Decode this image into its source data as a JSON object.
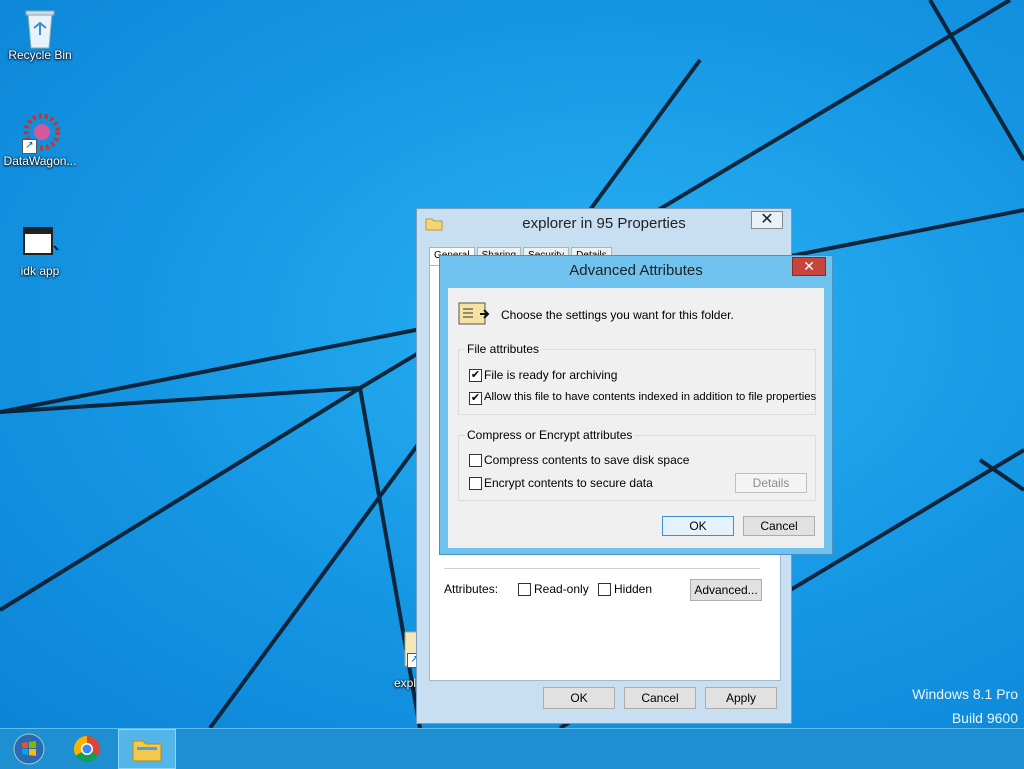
{
  "desktop": {
    "icons": [
      {
        "label": "Recycle Bin",
        "icon": "recycle-bin-icon"
      },
      {
        "label": "DataWagon...",
        "icon": "datawagon-icon"
      },
      {
        "label": "idk app",
        "icon": "app-icon"
      },
      {
        "label": "expl",
        "icon": "explorer-shortcut-icon"
      }
    ],
    "watermark": {
      "line1": "Windows 8.1 Pro",
      "line2": "Build 9600"
    }
  },
  "properties_window": {
    "title": "explorer in 95 Properties",
    "tabs": [
      "General",
      "Sharing",
      "Security",
      "Details"
    ],
    "attributes_label": "Attributes:",
    "readonly_label": "Read-only",
    "readonly_checked": false,
    "hidden_label": "Hidden",
    "hidden_checked": false,
    "advanced_button": "Advanced...",
    "ok": "OK",
    "cancel": "Cancel",
    "apply": "Apply"
  },
  "advanced_dialog": {
    "title": "Advanced Attributes",
    "close": "✕",
    "intro": "Choose the settings you want for this folder.",
    "file_attributes": {
      "title": "File attributes",
      "archive_label": "File is ready for archiving",
      "archive_checked": true,
      "index_label": "Allow this file to have contents indexed in addition to file properties",
      "index_checked": true
    },
    "compress_encrypt": {
      "title": "Compress or Encrypt attributes",
      "compress_label": "Compress contents to save disk space",
      "compress_checked": false,
      "encrypt_label": "Encrypt contents to secure data",
      "encrypt_checked": false,
      "details_button": "Details"
    },
    "ok": "OK",
    "cancel": "Cancel"
  },
  "taskbar": {
    "items": [
      "start-button",
      "chrome",
      "file-explorer"
    ]
  },
  "colors": {
    "desktop_blue": "#1ba0ec",
    "taskbar": "#1e8fd0",
    "close_red": "#c7453c"
  }
}
